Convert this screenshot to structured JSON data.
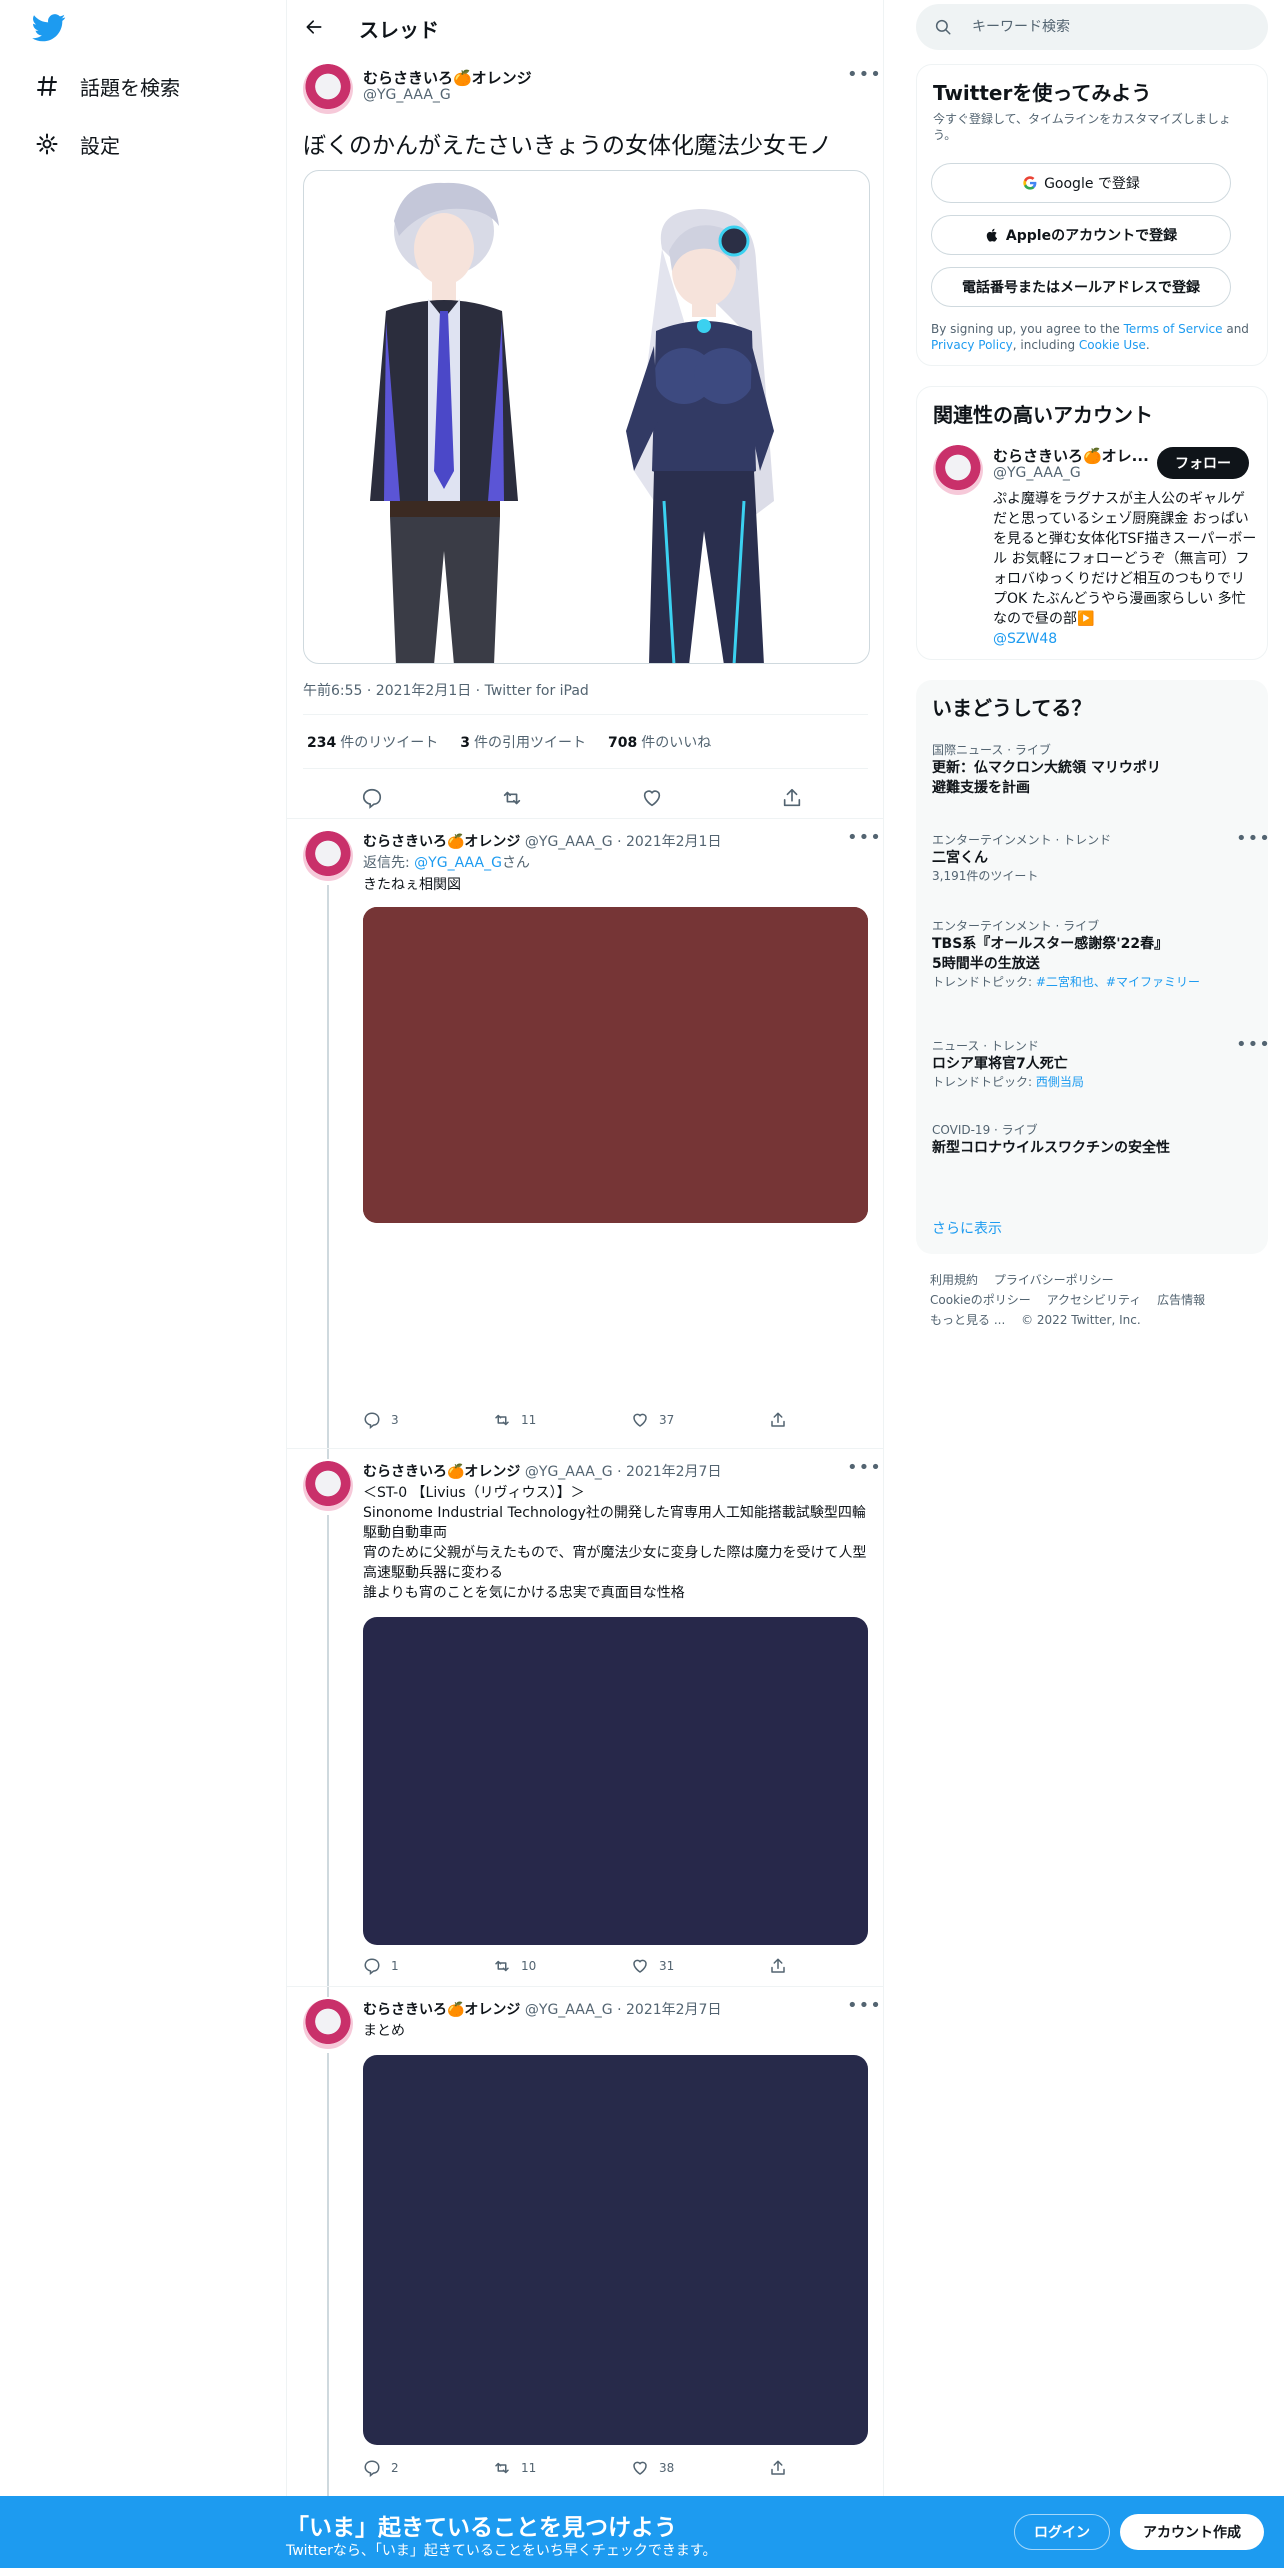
{
  "nav": {
    "logo": "twitter-bird-icon",
    "items": [
      {
        "icon": "hashtag-icon",
        "label": "話題を検索"
      },
      {
        "icon": "gear-icon",
        "label": "設定"
      }
    ]
  },
  "header": {
    "title": "スレッド",
    "back_icon": "arrow-left-icon"
  },
  "main_tweet": {
    "name": "むらさきいろ🍊オレンジ",
    "handle": "@YG_AAA_G",
    "text": "ぼくのかんがえたさいきょうの女体化魔法少女モノ",
    "meta": "午前6:55 · 2021年2月1日 · Twitter for iPad",
    "stats": {
      "retweets_count": "234",
      "retweets_label": "件のリツイート",
      "quotes_count": "3",
      "quotes_label": "件の引用ツイート",
      "likes_count": "708",
      "likes_label": "件のいいね"
    }
  },
  "replies": [
    {
      "name": "むらさきいろ🍊オレンジ",
      "handle": "@YG_AAA_G",
      "date": "· 2021年2月1日",
      "reply_to_prefix": "返信先: ",
      "reply_to_handle": "@YG_AAA_G",
      "reply_to_suffix": "さん",
      "text": "きたねぇ相関図",
      "media_color": "#763536",
      "replies": "3",
      "retweets": "11",
      "likes": "37"
    },
    {
      "name": "むらさきいろ🍊オレンジ",
      "handle": "@YG_AAA_G",
      "date": "· 2021年2月7日",
      "text_lines": [
        "＜ST-0 【Livius（リヴィウス）】＞",
        "Sinonome Industrial Technology社の開発した宵専用人工知能搭載試験型四輪駆動自動車両",
        "宵のために父親が与えたもので、宵が魔法少女に変身した際は魔力を受けて人型高速駆動兵器に変わる",
        "誰よりも宵のことを気にかける忠実で真面目な性格"
      ],
      "media_color": "#27284a",
      "replies": "1",
      "retweets": "10",
      "likes": "31"
    },
    {
      "name": "むらさきいろ🍊オレンジ",
      "handle": "@YG_AAA_G",
      "date": "· 2021年2月7日",
      "text": "まとめ",
      "media_color": "#272a4a",
      "replies": "2",
      "retweets": "11",
      "likes": "38"
    }
  ],
  "sidebar": {
    "search_placeholder": "キーワード検索",
    "signup": {
      "title": "Twitterを使ってみよう",
      "subtitle": "今すぐ登録して、タイムラインをカスタマイズしましょう。",
      "google": "Google で登録",
      "apple": "Appleのアカウントで登録",
      "phone": "電話番号またはメールアドレスで登録",
      "terms_1": "By signing up, you agree to the ",
      "terms_link": "Terms of Service",
      "terms_2": " and ",
      "privacy_link": "Privacy Policy",
      "terms_3": ", including ",
      "cookie_link": "Cookie Use",
      "terms_4": "."
    },
    "related": {
      "title": "関連性の高いアカウント",
      "name": "むらさきいろ🍊オレ...",
      "handle": "@YG_AAA_G",
      "follow": "フォロー",
      "bio": "ぷよ魔導をラグナスが主人公のギャルゲだと思っているシェゾ厨廃課金 おっぱいを見ると弾む女体化TSF描きスーパーボール お気軽にフォローどうぞ（無言可）フォロバゆっくりだけど相互のつもりでリプOK たぶんどうやら漫画家らしい 多忙なので昼の部▶️",
      "bio_link": "@SZW48"
    },
    "trends": {
      "title": "いまどうしてる？",
      "items": [
        {
          "category": "国際ニュース · ライブ",
          "name": "更新：仏マクロン大統領 マリウポリ避難支援を計画"
        },
        {
          "category": "エンターテインメント · トレンド",
          "name": "二宮くん",
          "sub": "3,191件のツイート"
        },
        {
          "category": "エンターテインメント · ライブ",
          "name": "TBS系『オールスター感謝祭'22春』5時間半の生放送",
          "sub_prefix": "トレンドトピック: ",
          "sub_links": "#二宮和也、#マイファミリー"
        },
        {
          "category": "ニュース · トレンド",
          "name": "ロシア軍将官7人死亡",
          "sub_prefix": "トレンドトピック: ",
          "sub_links": "西側当局"
        },
        {
          "category": "COVID-19 · ライブ",
          "name": "新型コロナウイルスワクチンの安全性"
        }
      ],
      "show_more": "さらに表示"
    },
    "footer": {
      "links": [
        "利用規約",
        "プライバシーポリシー",
        "Cookieのポリシー",
        "アクセシビリティ",
        "広告情報",
        "もっと見る ...",
        "© 2022 Twitter, Inc."
      ]
    }
  },
  "bottombar": {
    "title": "「いま」起きていることを見つけよう",
    "subtitle": "Twitterなら、「いま」起きていることをいち早くチェックできます。",
    "login": "ログイン",
    "signup": "アカウント作成"
  },
  "colors": {
    "accent": "#1d9bf0",
    "text": "#0f1419",
    "secondary": "#536471",
    "border": "#eff3f4"
  }
}
